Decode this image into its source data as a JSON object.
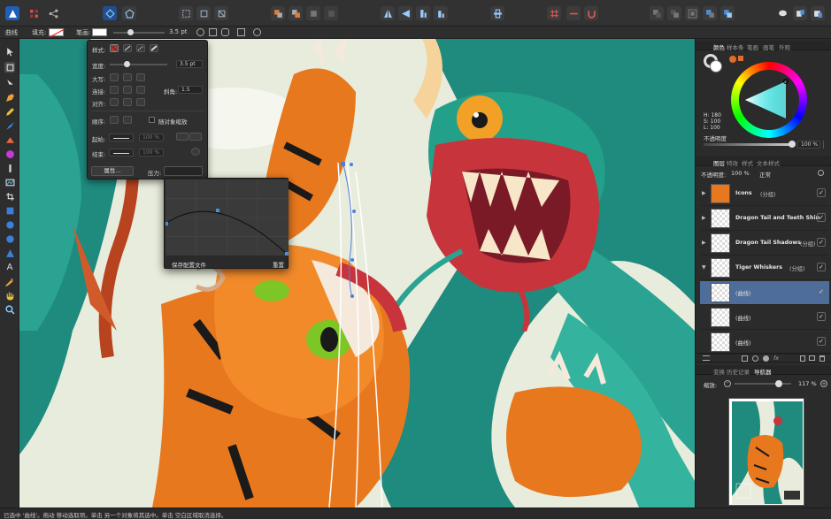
{
  "context_bar": {
    "tool_name": "曲线",
    "fill_label": "填充:",
    "stroke_label": "笔画:",
    "stroke_width": "3.5 pt"
  },
  "stroke_panel": {
    "style_label": "样式:",
    "width_label": "宽度:",
    "width_value": "3.5 pt",
    "cap_label": "大写:",
    "join_label": "连接:",
    "miter_label": "斜角:",
    "miter_value": "1.5",
    "align_label": "对齐:",
    "order_label": "顺序:",
    "scale_with_object_label": "随对象缩放",
    "start_label": "起始:",
    "start_value": "100 %",
    "end_label": "结束:",
    "end_value": "100 %",
    "properties_button": "属性...",
    "pressure_label": "压力:"
  },
  "pressure_popup": {
    "save_profile_button": "保存配置文件",
    "reset_button": "重置"
  },
  "color_panel": {
    "tabs": [
      "颜色",
      "样本条",
      "笔画",
      "画笔",
      "外观"
    ],
    "active_tab": "颜色",
    "h_value": "H: 180",
    "s_value": "S: 100",
    "l_value": "L: 100",
    "opacity_label": "不透明度",
    "opacity_value": "100 %"
  },
  "layers_panel": {
    "tabs": [
      "图层",
      "特效",
      "样式",
      "文本样式"
    ],
    "active_tab": "图层",
    "opacity_label": "不透明度:",
    "opacity_value": "100 %",
    "blend_mode": "正常",
    "layers": [
      {
        "name": "Icons",
        "suffix": "(分组)",
        "selected": false,
        "expandable": true,
        "checked": "✓"
      },
      {
        "name": "Dragon Tail and Teeth Shin",
        "suffix": "",
        "selected": false,
        "expandable": true,
        "checked": "✓"
      },
      {
        "name": "Dragon Tail Shadows",
        "suffix": "(分组)",
        "selected": false,
        "expandable": true,
        "checked": "✓"
      },
      {
        "name": "Tiger Whiskers",
        "suffix": "(分组)",
        "selected": false,
        "expandable": true,
        "checked": "✓"
      },
      {
        "name": "(曲线)",
        "suffix": "",
        "selected": true,
        "expandable": false,
        "checked": "✓"
      },
      {
        "name": "(曲线)",
        "suffix": "",
        "selected": false,
        "expandable": false,
        "checked": "✓"
      },
      {
        "name": "(曲线)",
        "suffix": "",
        "selected": false,
        "expandable": false,
        "checked": "✓"
      }
    ]
  },
  "navigator_panel": {
    "tabs": [
      "变换",
      "历史记录",
      "导航器"
    ],
    "active_tab": "导航器",
    "zoom_label": "缩放:",
    "zoom_value": "117 %"
  },
  "status_bar": {
    "text": "已选中 '曲线'。拖动 移动选取项。单击 另一个对象将其选中。单击 空白区域取消选择。"
  },
  "colors": {
    "accent": "#4f6d9a",
    "selected_layer": "#4f6d9a",
    "dragon_teal": "#1f8a7e",
    "tiger_orange": "#e8781e",
    "mouth_red": "#c8343c"
  }
}
